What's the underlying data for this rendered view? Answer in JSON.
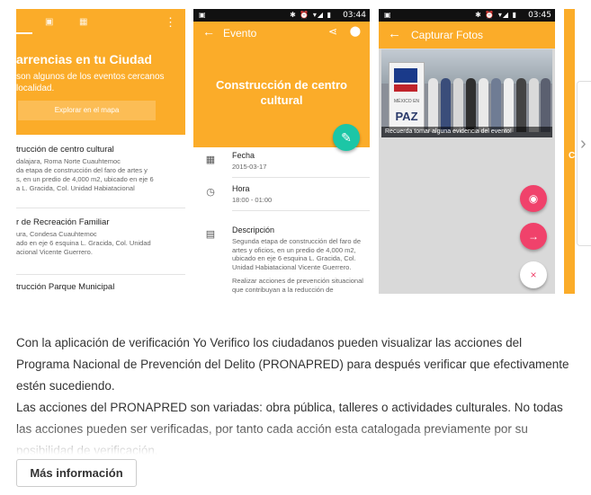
{
  "screens": {
    "s1": {
      "title": "arrencias en tu Ciudad",
      "subtitle_l1": "son algunos de los eventos  cercanos",
      "subtitle_l2": "localidad.",
      "map_button": "Explorar en el mapa",
      "events": [
        {
          "title": "trucción de centro cultural",
          "l1": "dalajara, Roma Norte Cuauhtemoc",
          "l2": "da etapa de construcción del faro de artes y",
          "l3": "s, en un predio de 4,000 m2, ubicado en eje 6",
          "l4": "a L. Gracida, Col. Unidad Habiatacional"
        },
        {
          "title": "r de Recreación Familiar",
          "l1": "ura, Condesa Cuauhtemoc",
          "l2": "ado en eje 6 esquina L. Gracida, Col. Unidad",
          "l3": "acional Vicente Guerrero.",
          "l4": ""
        },
        {
          "title": "trucción Parque Municipal",
          "l1": "",
          "l2": "",
          "l3": "",
          "l4": ""
        }
      ]
    },
    "s2": {
      "time": "03:44",
      "appbar_title": "Evento",
      "hero_title_l1": "Construcción de centro",
      "hero_title_l2": "cultural",
      "fecha_label": "Fecha",
      "fecha_value": "2015-03-17",
      "hora_label": "Hora",
      "hora_value": "18:00 - 01:00",
      "desc_label": "Descripción",
      "desc_l1": "Segunda etapa de construcción del faro de",
      "desc_l2": "artes y oficios, en un predio de 4,000 m2,",
      "desc_l3": "ubicado en eje 6 esquina L. Gracida, Col.",
      "desc_l4": "Unidad Habiatacional Vicente Guerrero.",
      "desc_l5": "Realizar acciones de prevención situacional",
      "desc_l6": "que contribuyan a la reducción de"
    },
    "s3": {
      "time": "03:45",
      "appbar_title": "Capturar Fotos",
      "sign_small": "MÉXICO EN",
      "sign_big": "PAZ",
      "caption": "Recuerda tomar alguna evidencia del evento!"
    },
    "s4": {
      "letter": "C"
    }
  },
  "description": {
    "p1": "Con la aplicación de verificación Yo Verifico los ciudadanos pueden visualizar las acciones del Programa Nacional de Prevención del Delito (PRONAPRED) para después verificar que efectivamente estén sucediendo.",
    "p2": "Las acciones del PRONAPRED son variadas: obra pública, talleres o actividades culturales. No todas las acciones pueden ser verificadas, por tanto cada acción esta catalogada previamente por su posibilidad de verificación."
  },
  "more_button": "Más información",
  "colors": {
    "brand": "#fbac29",
    "fab_edit": "#1cc6a6",
    "fab_action": "#f0426b"
  }
}
